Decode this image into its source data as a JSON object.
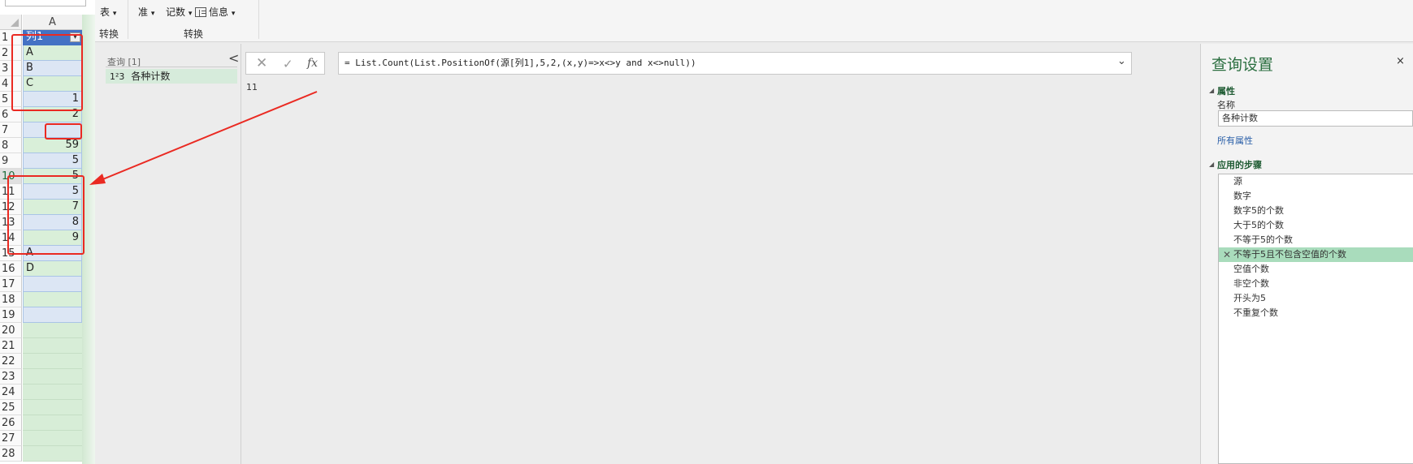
{
  "excel": {
    "column_header": "A",
    "row_numbers": [
      "1",
      "2",
      "3",
      "4",
      "5",
      "6",
      "7",
      "8",
      "9",
      "10",
      "11",
      "12",
      "13",
      "14",
      "15",
      "16",
      "17",
      "18",
      "19",
      "20",
      "21",
      "22",
      "23",
      "24",
      "25",
      "26",
      "27",
      "28"
    ],
    "cells": [
      "列1",
      "A",
      "B",
      "C",
      "1",
      "2",
      "",
      "59",
      "5",
      "5",
      "5",
      "7",
      "8",
      "9",
      "A",
      "D",
      "",
      "",
      ""
    ],
    "header_dropdown": "▾"
  },
  "ribbon": {
    "item1": "表",
    "item2": "准",
    "item3": "记数",
    "item4": "信息",
    "caret": "▾",
    "group1": "转换",
    "group2": "转换"
  },
  "queries": {
    "header": "查询 [1]",
    "collapse": "<",
    "item_type": "1²3",
    "item_name": "各种计数"
  },
  "formula": {
    "cancel": "✕",
    "confirm": "✓",
    "fx": "fx",
    "text": "= List.Count(List.PositionOf(源[列1],5,2,(x,y)=>x<>y and x<>null))",
    "chevron": "⌄",
    "result": "11"
  },
  "settings": {
    "title": "查询设置",
    "close": "×",
    "properties_title": "属性",
    "name_label": "名称",
    "name_value": "各种计数",
    "all_properties": "所有属性",
    "steps_title": "应用的步骤",
    "steps": [
      "源",
      "数字",
      "数字5的个数",
      "大于5的个数",
      "不等于5的个数",
      "不等于5且不包含空值的个数",
      "空值个数",
      "非空个数",
      "开头为5",
      "不重复个数"
    ],
    "active_step_index": 5,
    "delete_icon": "✕"
  },
  "colors": {
    "accent": "#2a6e3f",
    "annotation": "#ea2a22",
    "active_step": "#a9dcbc"
  }
}
